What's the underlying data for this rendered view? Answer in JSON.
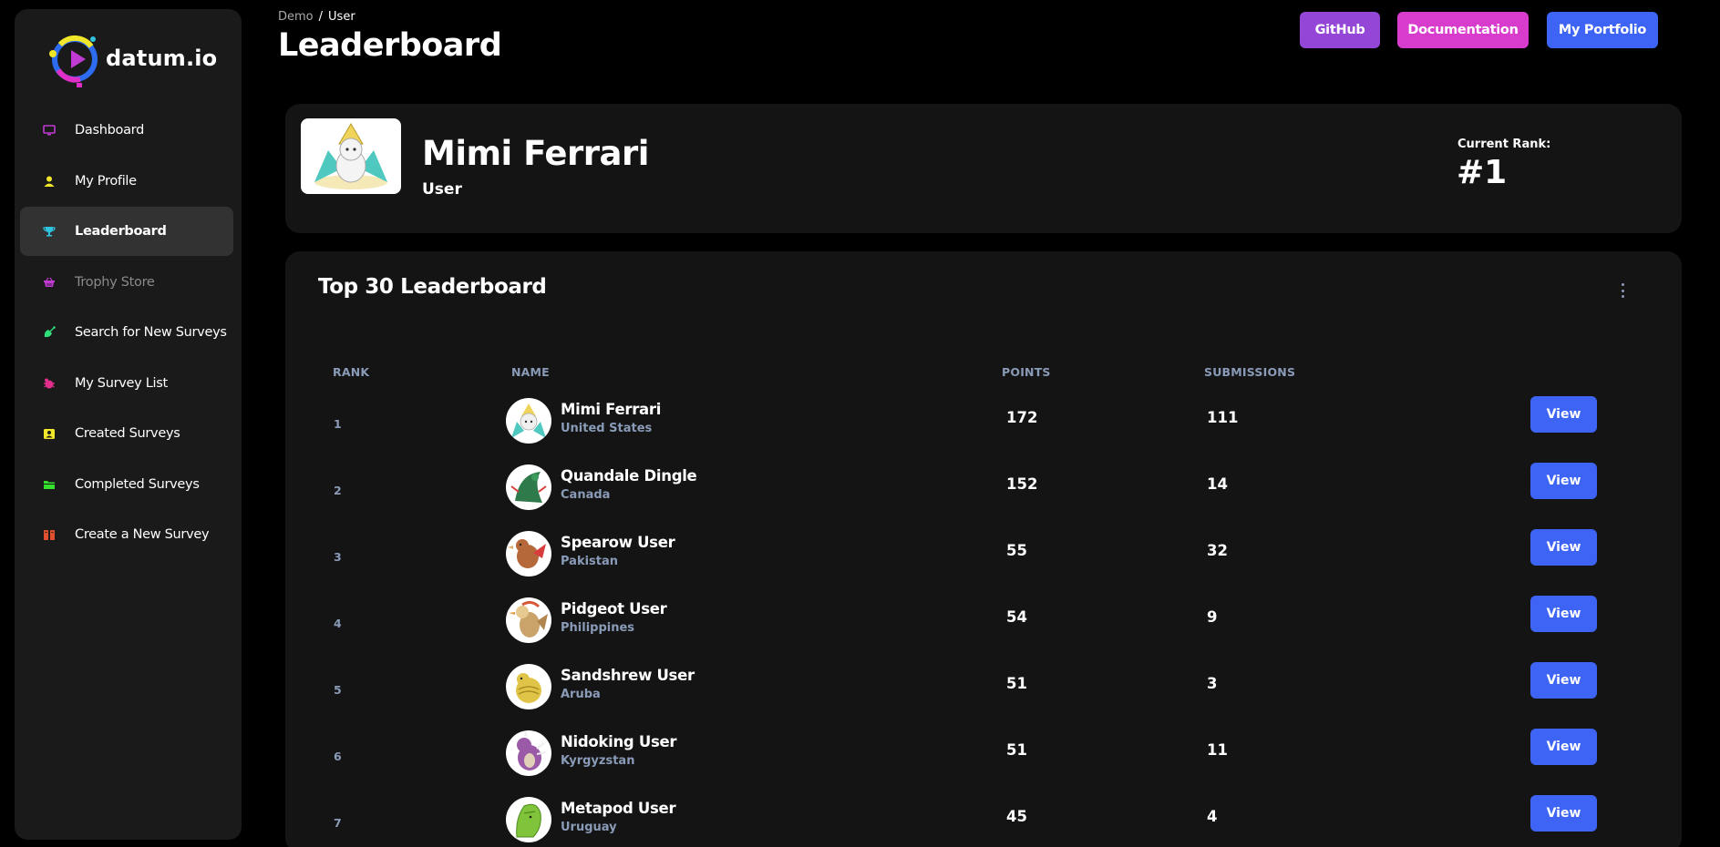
{
  "brand": {
    "name": "datum.io"
  },
  "sidebar": {
    "items": [
      {
        "label": "Dashboard",
        "icon": "monitor-icon",
        "color": "#c03bd1"
      },
      {
        "label": "My Profile",
        "icon": "user-icon",
        "color": "#f0e62a"
      },
      {
        "label": "Leaderboard",
        "icon": "trophy-icon",
        "color": "#2ec4e0",
        "active": true
      },
      {
        "label": "Trophy Store",
        "icon": "basket-icon",
        "color": "#c03bd1",
        "disabled": true
      },
      {
        "label": "Search for New Surveys",
        "icon": "satellite-icon",
        "color": "#2ee07a"
      },
      {
        "label": "My Survey List",
        "icon": "bug-icon",
        "color": "#e02e8a"
      },
      {
        "label": "Created Surveys",
        "icon": "badge-icon",
        "color": "#f0e62a"
      },
      {
        "label": "Completed Surveys",
        "icon": "folder-icon",
        "color": "#35e02e"
      },
      {
        "label": "Create a New Survey",
        "icon": "book-icon",
        "color": "#e0502e"
      }
    ]
  },
  "breadcrumb": {
    "root": "Demo",
    "separator": "/",
    "current": "User"
  },
  "header": {
    "title": "Leaderboard",
    "buttons": [
      {
        "label": "GitHub",
        "color": "#9447d6"
      },
      {
        "label": "Documentation",
        "color": "#d83ccd"
      },
      {
        "label": "My Portfolio",
        "color": "#3d64f5"
      }
    ]
  },
  "profile": {
    "name": "Mimi Ferrari",
    "role": "User",
    "rank_label": "Current Rank:",
    "rank_value": "#1"
  },
  "leaderboard": {
    "title": "Top 30 Leaderboard",
    "columns": {
      "rank": "RANK",
      "name": "NAME",
      "points": "POINTS",
      "submissions": "SUBMISSIONS"
    },
    "view_label": "View",
    "rows": [
      {
        "rank": "1",
        "name": "Mimi Ferrari",
        "country": "United States",
        "points": "172",
        "submissions": "111",
        "avatar_color": "#f3e08a"
      },
      {
        "rank": "2",
        "name": "Quandale Dingle",
        "country": "Canada",
        "points": "152",
        "submissions": "14",
        "avatar_color": "#2f7a4a"
      },
      {
        "rank": "3",
        "name": "Spearow User",
        "country": "Pakistan",
        "points": "55",
        "submissions": "32",
        "avatar_color": "#b5683a"
      },
      {
        "rank": "4",
        "name": "Pidgeot User",
        "country": "Philippines",
        "points": "54",
        "submissions": "9",
        "avatar_color": "#c9a36a"
      },
      {
        "rank": "5",
        "name": "Sandshrew User",
        "country": "Aruba",
        "points": "51",
        "submissions": "3",
        "avatar_color": "#e0c448"
      },
      {
        "rank": "6",
        "name": "Nidoking User",
        "country": "Kyrgyzstan",
        "points": "51",
        "submissions": "11",
        "avatar_color": "#9a5aa8"
      },
      {
        "rank": "7",
        "name": "Metapod User",
        "country": "Uruguay",
        "points": "45",
        "submissions": "4",
        "avatar_color": "#7fc43a"
      }
    ]
  }
}
